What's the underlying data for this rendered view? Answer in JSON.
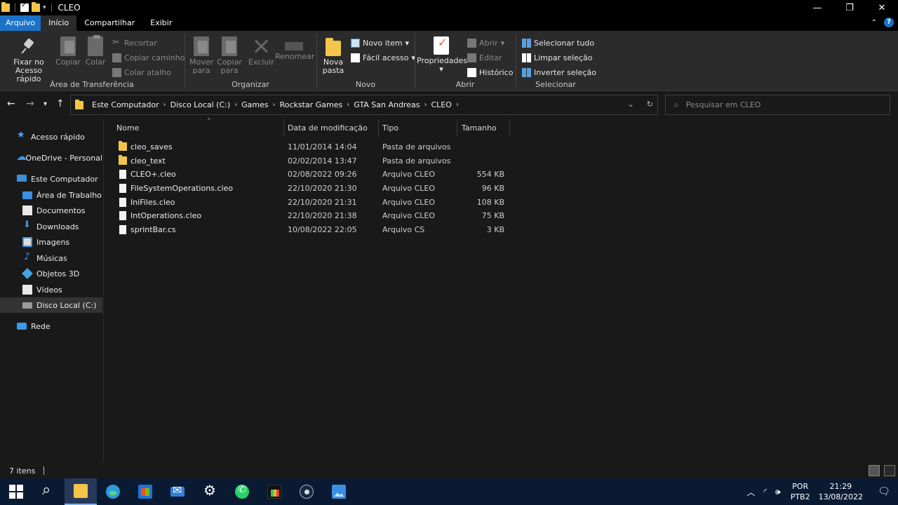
{
  "window": {
    "title": "CLEO",
    "controls": {
      "minimize": "—",
      "maximize": "❐",
      "close": "✕"
    }
  },
  "ribbon_tabs": [
    "Arquivo",
    "Início",
    "Compartilhar",
    "Exibir"
  ],
  "help_glyph": "?",
  "ribbon": {
    "clipboard": {
      "label": "Área de Transferência",
      "pin": [
        "Fixar no",
        "Acesso rápido"
      ],
      "copy": "Copiar",
      "paste": "Colar",
      "cut": "Recortar",
      "copy_path": "Copiar caminho",
      "paste_shortcut": "Colar atalho"
    },
    "organize": {
      "label": "Organizar",
      "move_to": [
        "Mover",
        "para"
      ],
      "copy_to": [
        "Copiar",
        "para"
      ],
      "delete": "Excluir",
      "rename": "Renomear"
    },
    "new": {
      "label": "Novo",
      "new_folder": [
        "Nova",
        "pasta"
      ],
      "new_item": "Novo item",
      "easy_access": "Fácil acesso"
    },
    "open": {
      "label": "Abrir",
      "properties": "Propriedades",
      "open": "Abrir",
      "edit": "Editar",
      "history": "Histórico"
    },
    "select": {
      "label": "Selecionar",
      "select_all": "Selecionar tudo",
      "select_none": "Limpar seleção",
      "invert": "Inverter seleção"
    }
  },
  "address": {
    "crumbs": [
      "Este Computador",
      "Disco Local (C:)",
      "Games",
      "Rockstar Games",
      "GTA San Andreas",
      "CLEO"
    ],
    "search_placeholder": "Pesquisar em CLEO"
  },
  "sidebar": {
    "items": [
      {
        "label": "Acesso rápido",
        "icon": "star-icon"
      },
      {
        "label": "OneDrive - Personal",
        "icon": "cloud-icon"
      },
      {
        "label": "Este Computador",
        "icon": "computer-icon"
      },
      {
        "label": "Área de Trabalho",
        "icon": "desktop-icon"
      },
      {
        "label": "Documentos",
        "icon": "documents-icon"
      },
      {
        "label": "Downloads",
        "icon": "download-icon"
      },
      {
        "label": "Imagens",
        "icon": "pictures-icon"
      },
      {
        "label": "Músicas",
        "icon": "music-icon"
      },
      {
        "label": "Objetos 3D",
        "icon": "3d-objects-icon"
      },
      {
        "label": "Vídeos",
        "icon": "videos-icon"
      },
      {
        "label": "Disco Local (C:)",
        "icon": "disk-icon",
        "selected": true
      },
      {
        "label": "Rede",
        "icon": "network-icon"
      }
    ]
  },
  "files": {
    "columns": [
      "Nome",
      "Data de modificação",
      "Tipo",
      "Tamanho"
    ],
    "rows": [
      {
        "name": "cleo_saves",
        "date": "11/01/2014 14:04",
        "type": "Pasta de arquivos",
        "size": "",
        "kind": "folder"
      },
      {
        "name": "cleo_text",
        "date": "02/02/2014 13:47",
        "type": "Pasta de arquivos",
        "size": "",
        "kind": "folder"
      },
      {
        "name": "CLEO+.cleo",
        "date": "02/08/2022 09:26",
        "type": "Arquivo CLEO",
        "size": "554 KB",
        "kind": "file"
      },
      {
        "name": "FileSystemOperations.cleo",
        "date": "22/10/2020 21:30",
        "type": "Arquivo CLEO",
        "size": "96 KB",
        "kind": "file"
      },
      {
        "name": "IniFiles.cleo",
        "date": "22/10/2020 21:31",
        "type": "Arquivo CLEO",
        "size": "108 KB",
        "kind": "file"
      },
      {
        "name": "IntOperations.cleo",
        "date": "22/10/2020 21:38",
        "type": "Arquivo CLEO",
        "size": "75 KB",
        "kind": "file"
      },
      {
        "name": "sprintBar.cs",
        "date": "10/08/2022 22:05",
        "type": "Arquivo CS",
        "size": "3 KB",
        "kind": "file"
      }
    ]
  },
  "status": {
    "count": "7 itens"
  },
  "taskbar": {
    "lang": [
      "POR",
      "PTB2"
    ],
    "time": "21:29",
    "date": "13/08/2022"
  },
  "colors": {
    "accent": "#1a73c8",
    "background": "#191919",
    "ribbon": "#2b2b2b",
    "taskbar": "#0b1a33",
    "folder": "#f4c54a"
  }
}
